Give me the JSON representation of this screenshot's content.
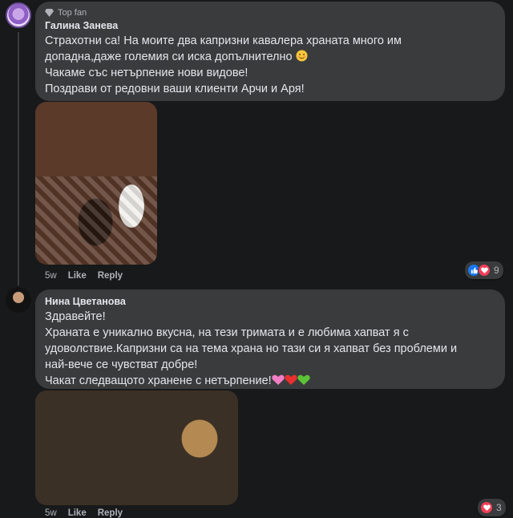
{
  "comments": [
    {
      "badge": "Top fan",
      "author": "Галина Занева",
      "lines": [
        "Страхотни са! На моите два капризни кавалера храната много им",
        "допадна,даже големия си иска допълнително",
        "Чакаме със нетърпение нови видове!",
        "Поздрави от редовни ваши клиенти Арчи и Аря!"
      ],
      "photo": "photo-of-two-cavalier-dogs",
      "time": "5w",
      "like_label": "Like",
      "reply_label": "Reply",
      "reaction_count": "9",
      "reactions": [
        "like",
        "love"
      ]
    },
    {
      "author": "Нина Цветанова",
      "lines": [
        "Здравейте!",
        "Храната е уникално вкусна, на тези тримата и е любима хапват я с",
        "удоволствие.Капризни са на тема храна но тази си я хапват без проблеми и",
        "най-вече се чувстват добре!",
        "Чакат следващото хранене с нетърпение!"
      ],
      "photo": "photo-of-three-yorkshire-terriers",
      "time": "5w",
      "like_label": "Like",
      "reply_label": "Reply",
      "reaction_count": "3",
      "reactions": [
        "love"
      ]
    }
  ],
  "colors": {
    "background": "#18191a",
    "bubble": "#3a3b3c",
    "like": "#1877f2",
    "love": "#f33e58"
  }
}
